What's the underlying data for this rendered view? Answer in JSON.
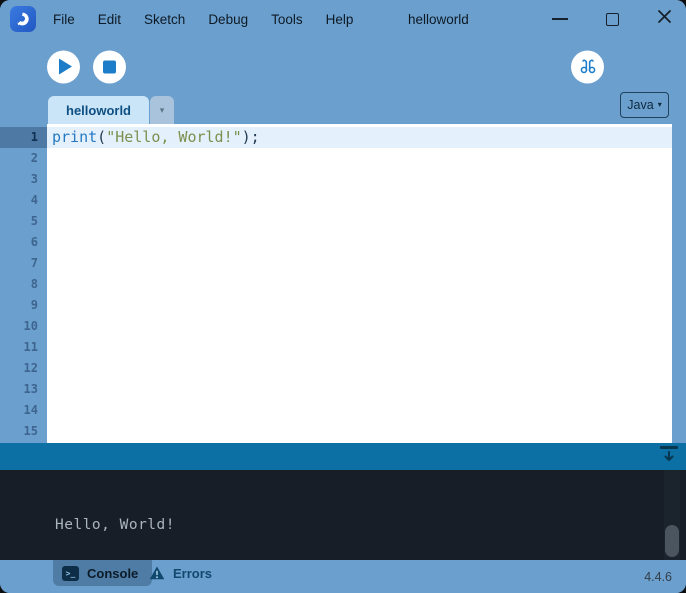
{
  "titlebar": {
    "menus": [
      "File",
      "Edit",
      "Sketch",
      "Debug",
      "Tools",
      "Help"
    ],
    "title": "helloworld"
  },
  "toolbar": {
    "mode_selector": {
      "label": "Java",
      "arrow": "▾"
    }
  },
  "tabbar": {
    "active_tab": "helloworld",
    "dropdown_arrow": "▾"
  },
  "editor": {
    "active_line": 1,
    "line_numbers": [
      "1",
      "2",
      "3",
      "4",
      "5",
      "6",
      "7",
      "8",
      "9",
      "10",
      "11",
      "12",
      "13",
      "14",
      "15"
    ],
    "code_line": {
      "function": "print",
      "open_paren": "(",
      "string_literal": "\"Hello, World!\"",
      "close": ");"
    }
  },
  "console": {
    "output": "Hello, World!"
  },
  "footer": {
    "console_tab": "Console",
    "errors_tab": "Errors",
    "terminal_glyph": ">_",
    "version": "4.4.6"
  },
  "colors": {
    "titlebar_blue": "#6B9FCD",
    "accent_blue": "#1E7DC8",
    "divider_blue": "#0C70A4",
    "console_bg": "#171E27",
    "tab_bg": "#CBE5F8",
    "active_footer_tab": "#4F7CA4",
    "keyword": "#2479C2",
    "string_literal": "#7D8F4E",
    "punctuation": "#223A52"
  }
}
